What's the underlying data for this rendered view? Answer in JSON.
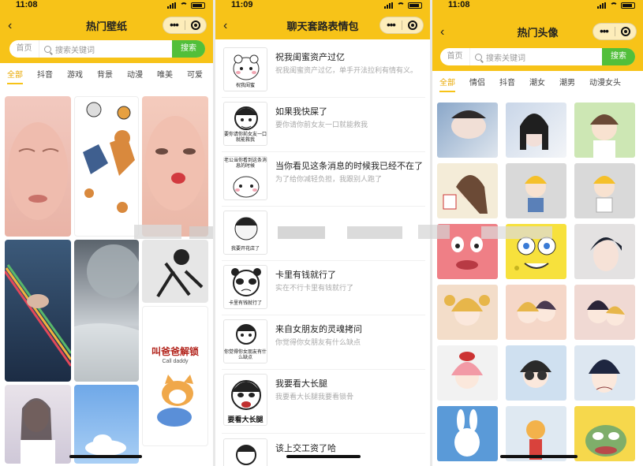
{
  "phones": {
    "wallpaper": {
      "time": "11:08",
      "title": "热门壁纸",
      "search_home": "首页",
      "search_placeholder": "搜索关键词",
      "search_button": "搜索",
      "tabs": [
        "全部",
        "抖音",
        "游戏",
        "背景",
        "动漫",
        "唯美",
        "可爱"
      ],
      "active_tab": 0,
      "tile_text": {
        "call_daddy_cn": "叫爸爸解锁",
        "call_daddy_en": "Call daddy"
      }
    },
    "stickers": {
      "time": "11:09",
      "title": "聊天套路表情包",
      "items": [
        {
          "title": "祝我闺蜜资产过亿",
          "subtitle": "祝我闺蜜资产过亿，单手开法拉利有情有义。",
          "caption": "祝我闺蜜"
        },
        {
          "title": "如果我快屎了",
          "subtitle": "要你请你前女友一口就能救我",
          "caption": "要你请你前女友一口就能救我"
        },
        {
          "title": "当你看见这条消息的时候我已经不在了",
          "subtitle": "为了给你减轻负担，我跟别人跑了",
          "caption": "老公当你看到这条消息的时候"
        },
        {
          "title": "",
          "subtitle": "",
          "caption": "我要开花店了"
        },
        {
          "title": "卡里有钱就行了",
          "subtitle": "实在不行卡里有钱就行了",
          "caption": "卡里有钱就行了"
        },
        {
          "title": "来自女朋友的灵魂拷问",
          "subtitle": "你觉得你女朋友有什么缺点",
          "caption": "你觉得你女朋友有什么缺点"
        },
        {
          "title": "我要看大长腿",
          "subtitle": "我要看大长腿我要看锁骨",
          "caption": "要看大长腿"
        },
        {
          "title": "该上交工资了哈",
          "subtitle": "",
          "caption": ""
        }
      ]
    },
    "avatars": {
      "time": "11:08",
      "title": "热门头像",
      "search_home": "首页",
      "search_placeholder": "搜索关键词",
      "search_button": "搜索",
      "tabs": [
        "全部",
        "情侣",
        "抖音",
        "潮女",
        "潮男",
        "动漫女头"
      ],
      "active_tab": 0
    }
  },
  "colors": {
    "brand_yellow": "#f7c318",
    "search_green": "#52bf3a",
    "active_tab": "#e9a800"
  }
}
